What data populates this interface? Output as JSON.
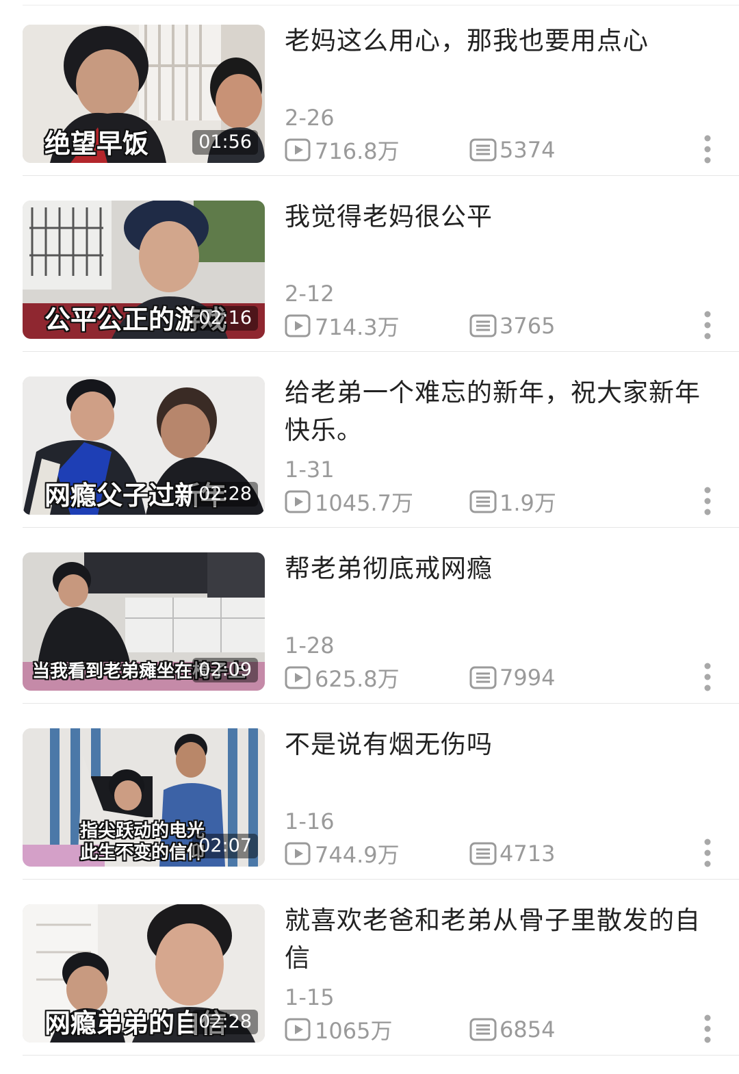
{
  "videos": [
    {
      "title": "老妈这么用心，那我也要用点心",
      "caption": "绝望早饭",
      "duration": "01:56",
      "date": "2-26",
      "views": "716.8万",
      "comments": "5374"
    },
    {
      "title": "我觉得老妈很公平",
      "caption": "公平公正的游戏",
      "duration": "02:16",
      "date": "2-12",
      "views": "714.3万",
      "comments": "3765"
    },
    {
      "title": "给老弟一个难忘的新年，祝大家新年快乐。",
      "caption": "网瘾父子过新年",
      "duration": "02:28",
      "date": "1-31",
      "views": "1045.7万",
      "comments": "1.9万"
    },
    {
      "title": "帮老弟彻底戒网瘾",
      "caption": "当我看到老弟瘫坐在椅子上",
      "duration": "02:09",
      "date": "1-28",
      "views": "625.8万",
      "comments": "7994"
    },
    {
      "title": "不是说有烟无伤吗",
      "caption": "指尖跃动的电光\n此生不变的信仰",
      "duration": "02:07",
      "date": "1-16",
      "views": "744.9万",
      "comments": "4713"
    },
    {
      "title": "就喜欢老爸和老弟从骨子里散发的自信",
      "caption": "网瘾弟弟的自信",
      "duration": "02:28",
      "date": "1-15",
      "views": "1065万",
      "comments": "6854"
    }
  ],
  "icons": {
    "views": "play-icon",
    "comments": "comment-list-icon",
    "more": "more-vertical-icon"
  },
  "colors": {
    "meta_text": "#9a9a9a",
    "title_text": "#222222",
    "divider": "#e6e6e6"
  }
}
